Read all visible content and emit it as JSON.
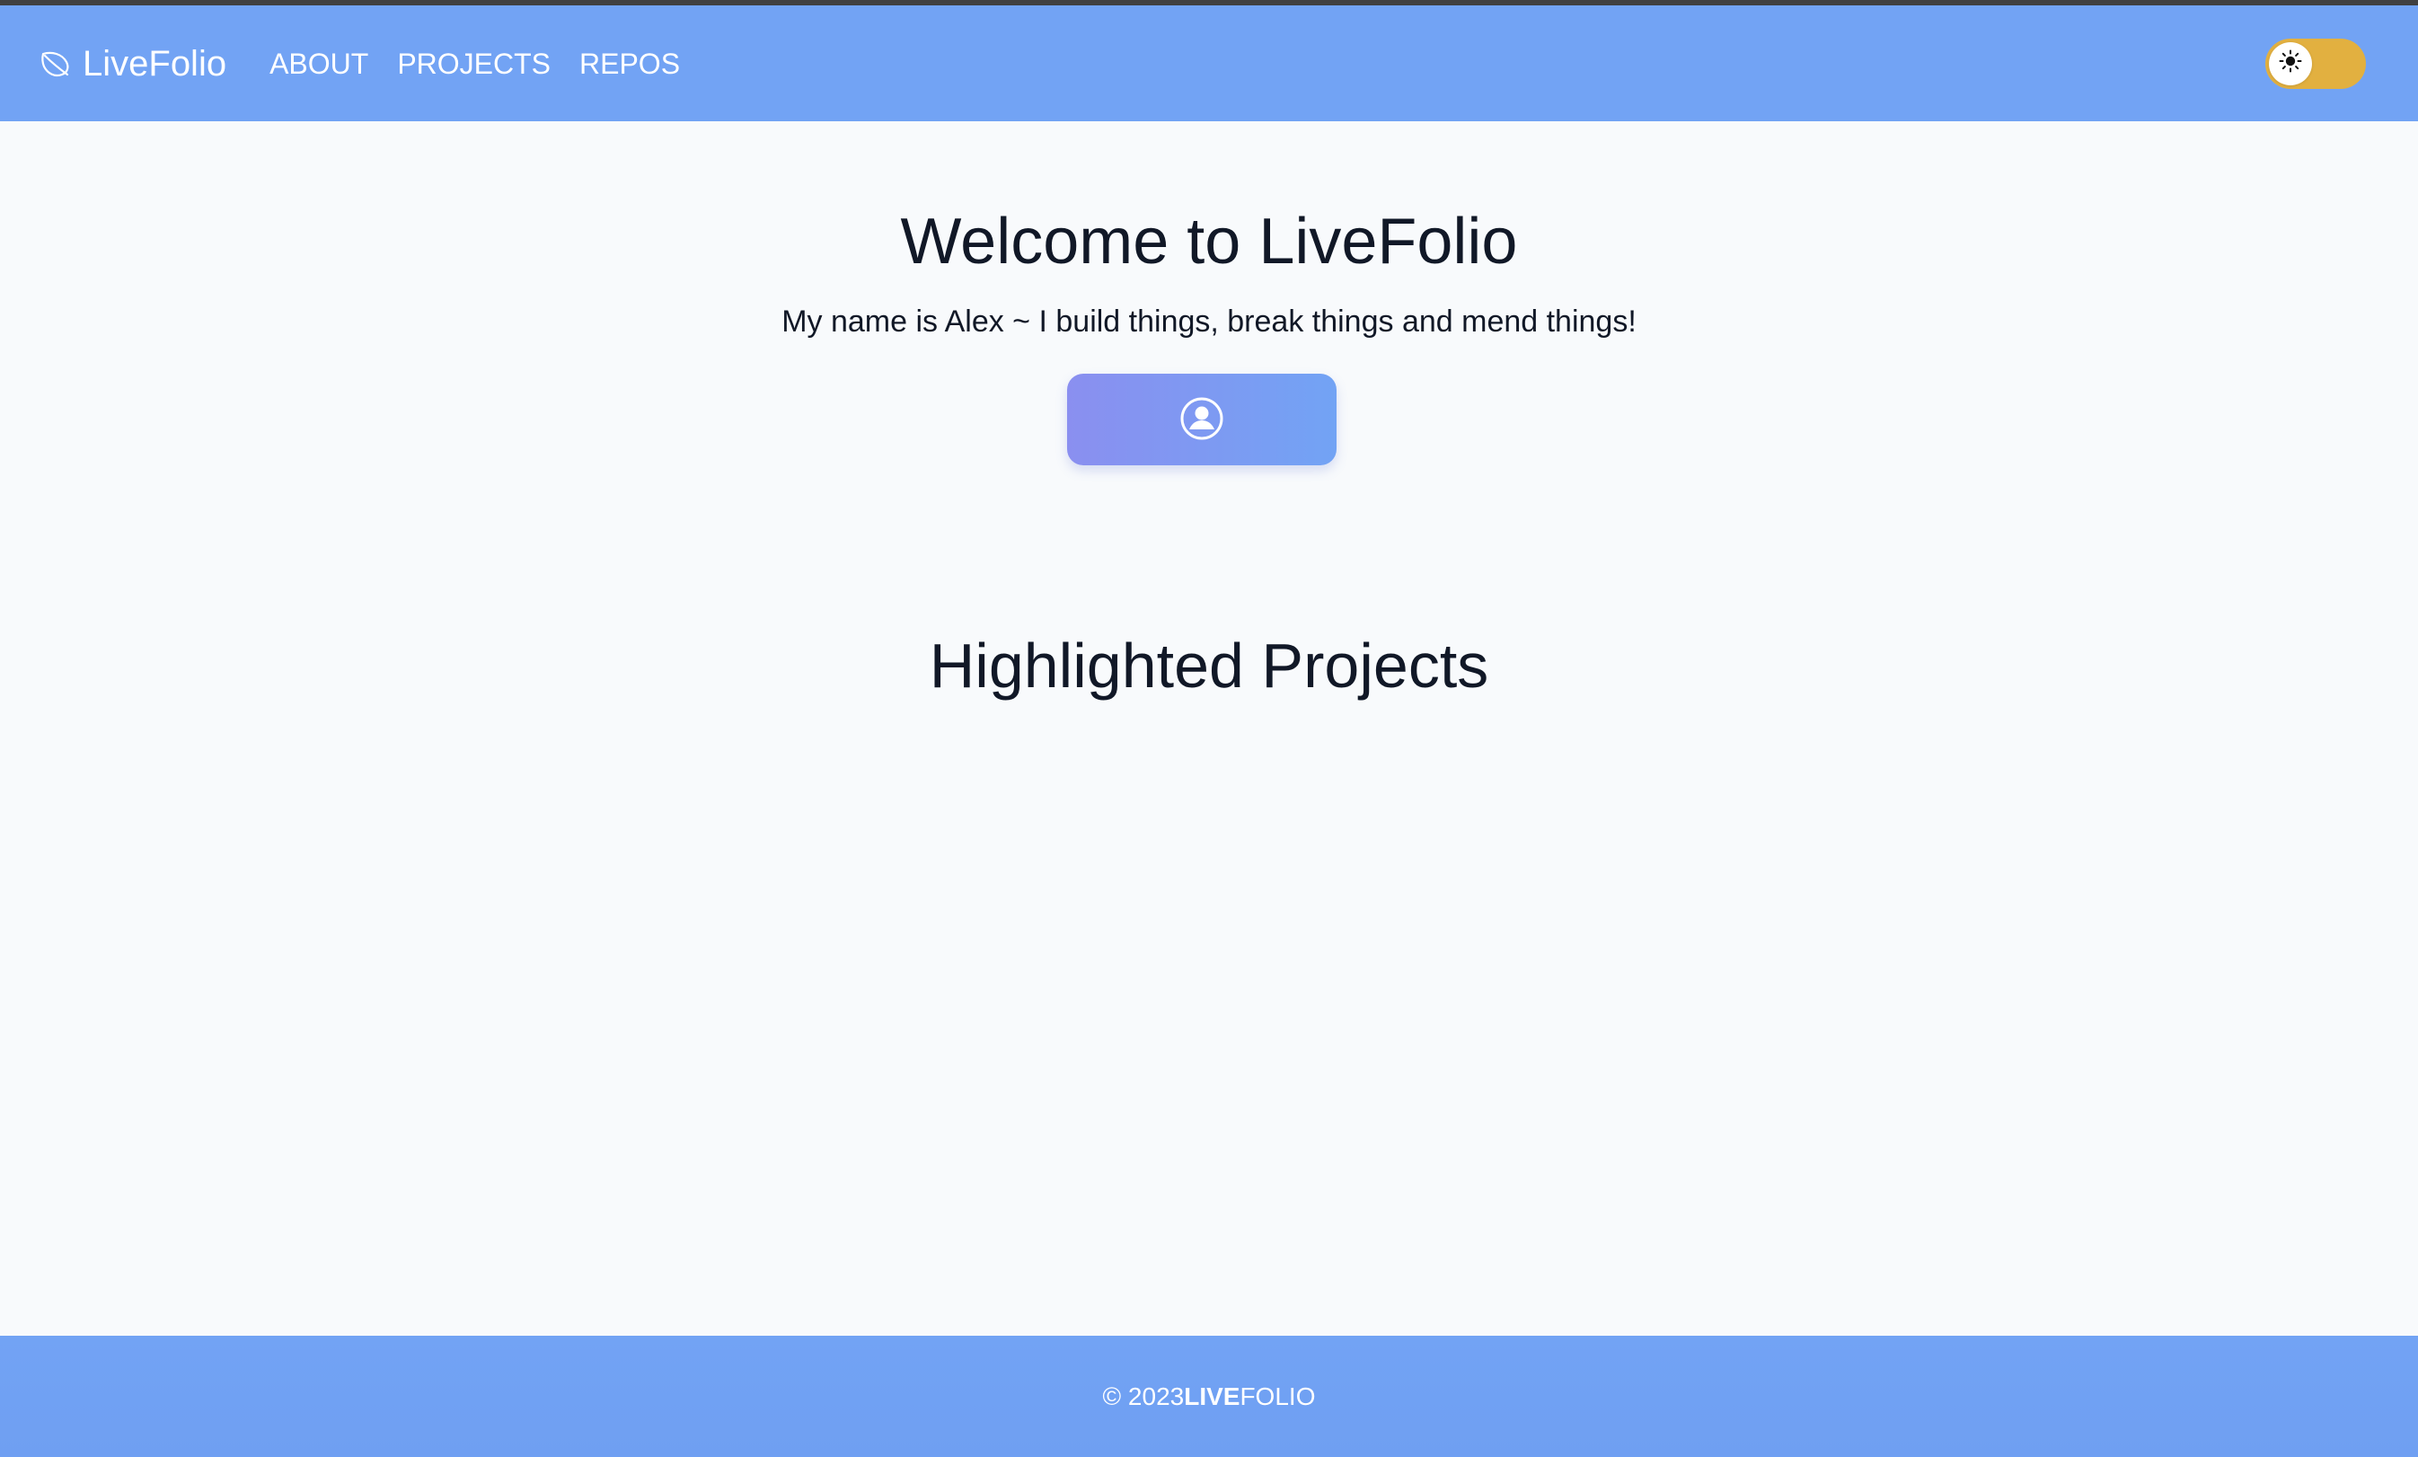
{
  "header": {
    "brand": "LiveFolio",
    "nav": [
      {
        "label": "ABOUT"
      },
      {
        "label": "PROJECTS"
      },
      {
        "label": "REPOS"
      }
    ],
    "theme_toggle": {
      "state": "light"
    }
  },
  "hero": {
    "title": "Welcome to LiveFolio",
    "subtitle": "My name is Alex ~ I build things, break things and mend things!"
  },
  "sections": {
    "highlighted_projects_title": "Highlighted Projects"
  },
  "footer": {
    "copyright": "© 2023 ",
    "brand_strong": "LIVE",
    "brand_light": "FOLIO"
  },
  "colors": {
    "header_bg": "#72a3f4",
    "page_bg": "#f8fafc",
    "toggle_bg": "#e2b040",
    "button_gradient_start": "#8a8ff0",
    "button_gradient_end": "#72a3f4"
  },
  "icons": {
    "brand": "leaf-icon",
    "toggle": "sun-icon",
    "profile": "user-circle-icon"
  }
}
